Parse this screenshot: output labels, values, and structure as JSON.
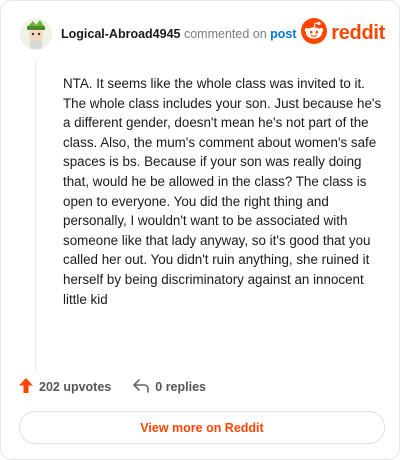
{
  "comment": {
    "username": "Logical-Abroad4945",
    "action_text": "commented on",
    "post_link_text": "post",
    "body": "NTA. It seems like the whole class was invited to it. The whole class includes your son. Just because he's a different gender, doesn't mean he's not part of the class. Also, the mum's comment about women's safe spaces is bs. Because if your son was really doing that, would he be allowed in the class? The class is open to everyone. You did the right thing and personally, I wouldn't want to be associated with someone like that lady anyway, so it's good that you called her out. You didn't ruin anything, she ruined it herself by being discriminatory against an innocent little kid"
  },
  "brand": {
    "icon": "reddit-alien-icon",
    "wordmark": "reddit",
    "color": "#ff4500"
  },
  "footer": {
    "upvotes_label": "202 upvotes",
    "replies_label": "0 replies"
  },
  "cta": {
    "label": "View more on Reddit"
  },
  "colors": {
    "accent": "#ff4500",
    "link": "#0079d3",
    "text": "#1a1a1b",
    "muted": "#7c7c7c"
  }
}
